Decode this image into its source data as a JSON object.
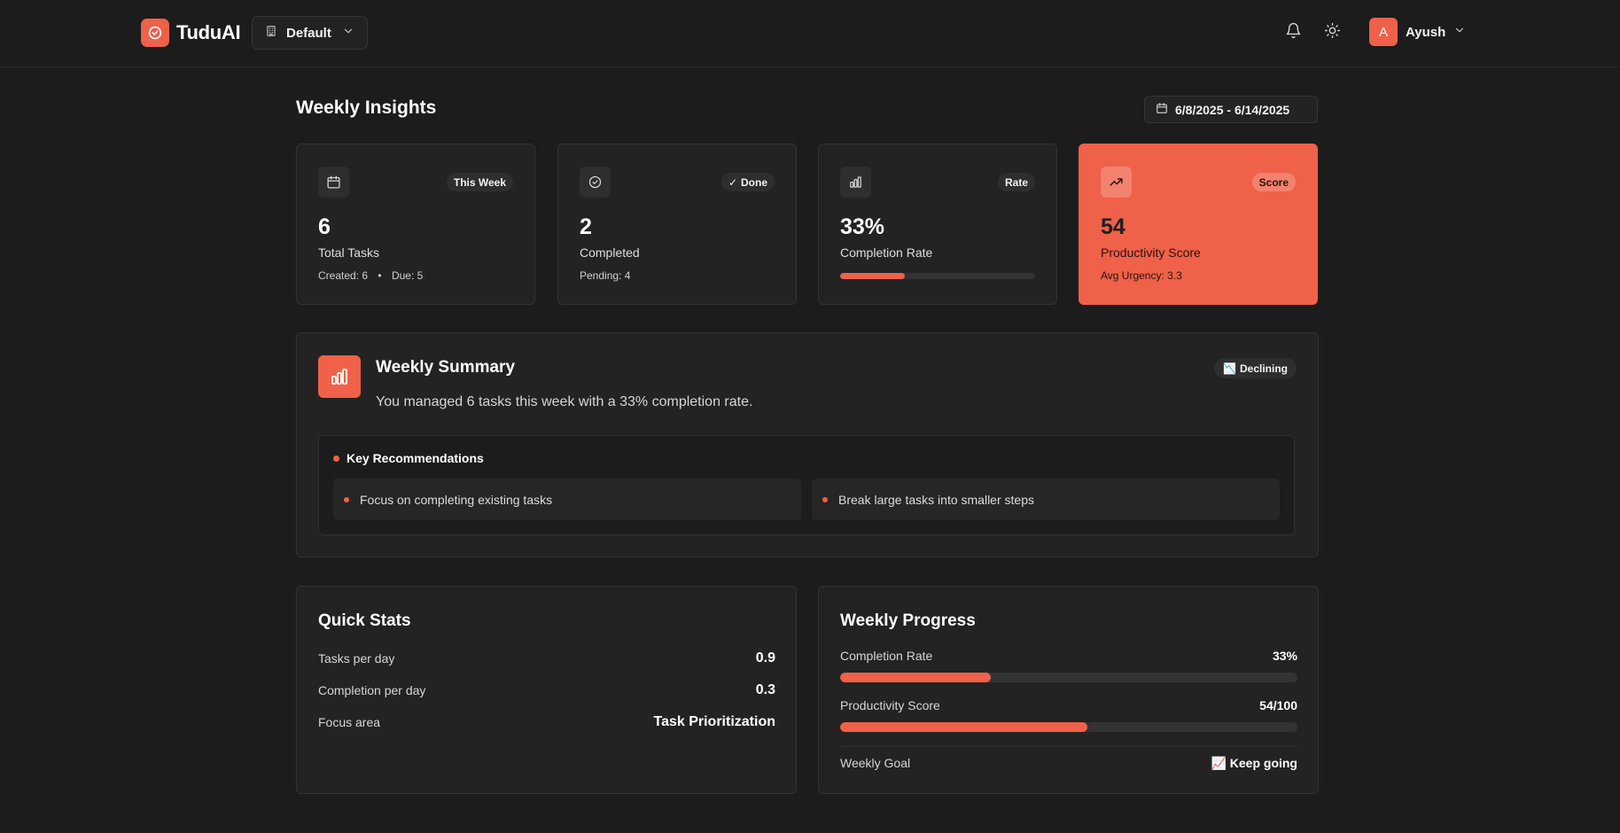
{
  "app": {
    "name": "TuduAI"
  },
  "workspace": {
    "selected": "Default"
  },
  "user": {
    "initial": "A",
    "name": "Ayush"
  },
  "page": {
    "title": "Weekly Insights",
    "date_range": "6/8/2025 - 6/14/2025"
  },
  "cards": [
    {
      "badge": "This Week",
      "value": "6",
      "label": "Total Tasks",
      "sub_created": "Created: 6",
      "sub_sep": "•",
      "sub_due": "Due: 5",
      "icon": "calendar-icon"
    },
    {
      "badge_check": "✓",
      "badge": "Done",
      "value": "2",
      "label": "Completed",
      "sub": "Pending: 4",
      "icon": "check-circle-icon"
    },
    {
      "badge": "Rate",
      "value": "33%",
      "label": "Completion Rate",
      "progress": 0.33,
      "icon": "bar-chart-icon"
    },
    {
      "badge": "Score",
      "value": "54",
      "label": "Productivity Score",
      "sub": "Avg Urgency: 3.3",
      "icon": "trending-up-icon"
    }
  ],
  "summary": {
    "title": "Weekly Summary",
    "text": "You managed 6 tasks this week with a 33% completion rate.",
    "trend_emoji": "📉",
    "trend": "Declining",
    "recommendations_title": "Key Recommendations",
    "recommendations": [
      "Focus on completing existing tasks",
      "Break large tasks into smaller steps"
    ]
  },
  "quick_stats": {
    "title": "Quick Stats",
    "rows": [
      {
        "label": "Tasks per day",
        "value": "0.9"
      },
      {
        "label": "Completion per day",
        "value": "0.3"
      },
      {
        "label": "Focus area",
        "value": "Task Prioritization"
      }
    ]
  },
  "weekly_progress": {
    "title": "Weekly Progress",
    "completion_label": "Completion Rate",
    "completion_value": "33%",
    "completion_progress": 0.33,
    "score_label": "Productivity Score",
    "score_value": "54/100",
    "score_progress": 0.54,
    "goal_label": "Weekly Goal",
    "goal_emoji": "📈",
    "goal_value": "Keep going"
  },
  "colors": {
    "accent": "#ef6149",
    "background": "#1c1c1c",
    "card": "#232323"
  }
}
